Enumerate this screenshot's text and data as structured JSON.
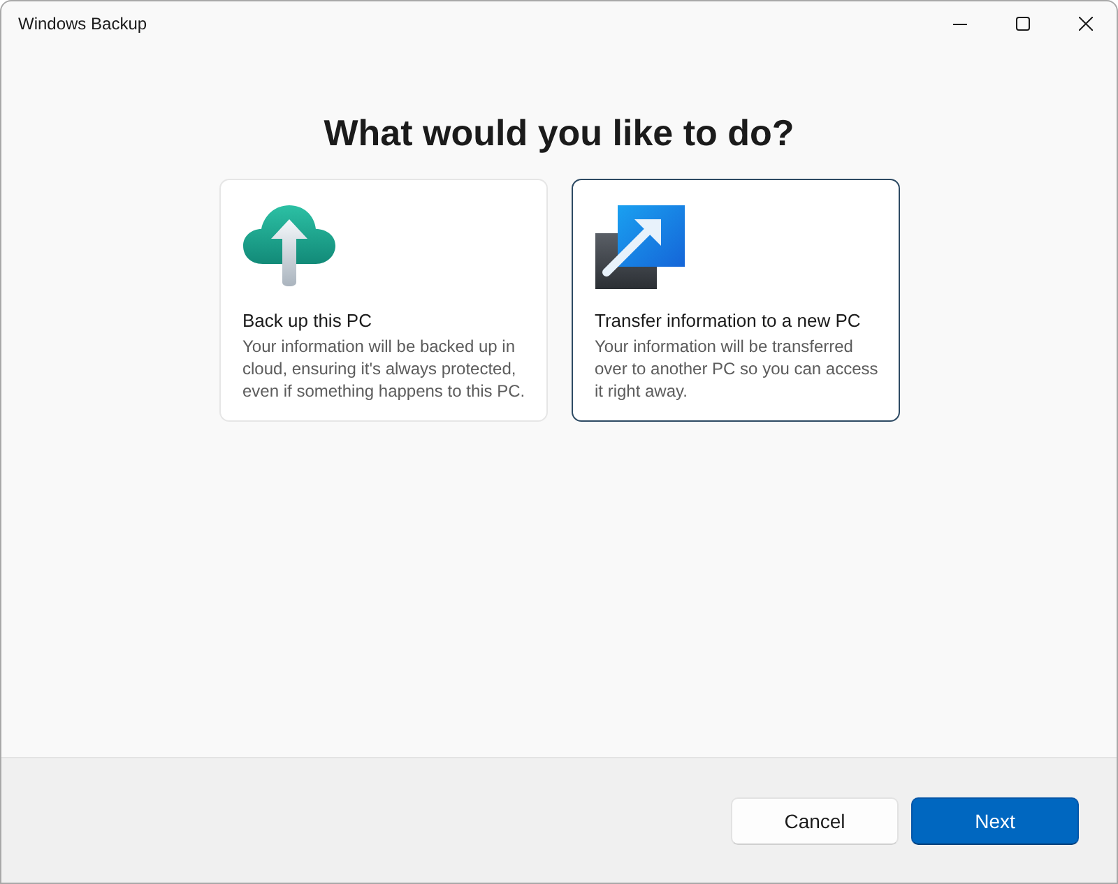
{
  "window": {
    "title": "Windows Backup"
  },
  "heading": "What would you like to do?",
  "options": [
    {
      "kind": "cloud",
      "title": "Back up this PC",
      "description": "Your information will be backed up in cloud, ensuring it's always protected, even if something happens to this PC.",
      "selected": false
    },
    {
      "kind": "transfer",
      "title": "Transfer information to a new PC",
      "description": "Your information will be transferred over to another PC so you can access it right away.",
      "selected": true
    }
  ],
  "buttons": [
    {
      "kind": "secondary",
      "label": "Cancel"
    },
    {
      "kind": "primary",
      "label": "Next"
    }
  ]
}
